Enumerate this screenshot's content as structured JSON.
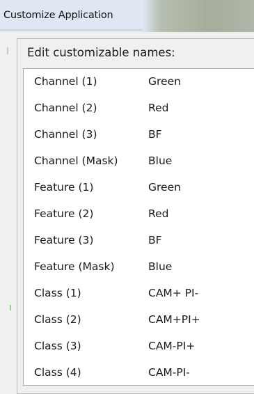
{
  "window": {
    "title": "Customize Application"
  },
  "group": {
    "label": "Edit customizable names:"
  },
  "rows": [
    {
      "key": "Channel (1)",
      "value": "Green"
    },
    {
      "key": "Channel (2)",
      "value": "Red"
    },
    {
      "key": "Channel (3)",
      "value": "BF"
    },
    {
      "key": "Channel (Mask)",
      "value": "Blue"
    },
    {
      "key": "Feature (1)",
      "value": "Green"
    },
    {
      "key": "Feature (2)",
      "value": "Red"
    },
    {
      "key": "Feature (3)",
      "value": "BF"
    },
    {
      "key": "Feature (Mask)",
      "value": "Blue"
    },
    {
      "key": "Class (1)",
      "value": "CAM+ PI-"
    },
    {
      "key": "Class (2)",
      "value": "CAM+PI+"
    },
    {
      "key": "Class (3)",
      "value": "CAM-PI+"
    },
    {
      "key": "Class (4)",
      "value": "CAM-PI-"
    }
  ]
}
